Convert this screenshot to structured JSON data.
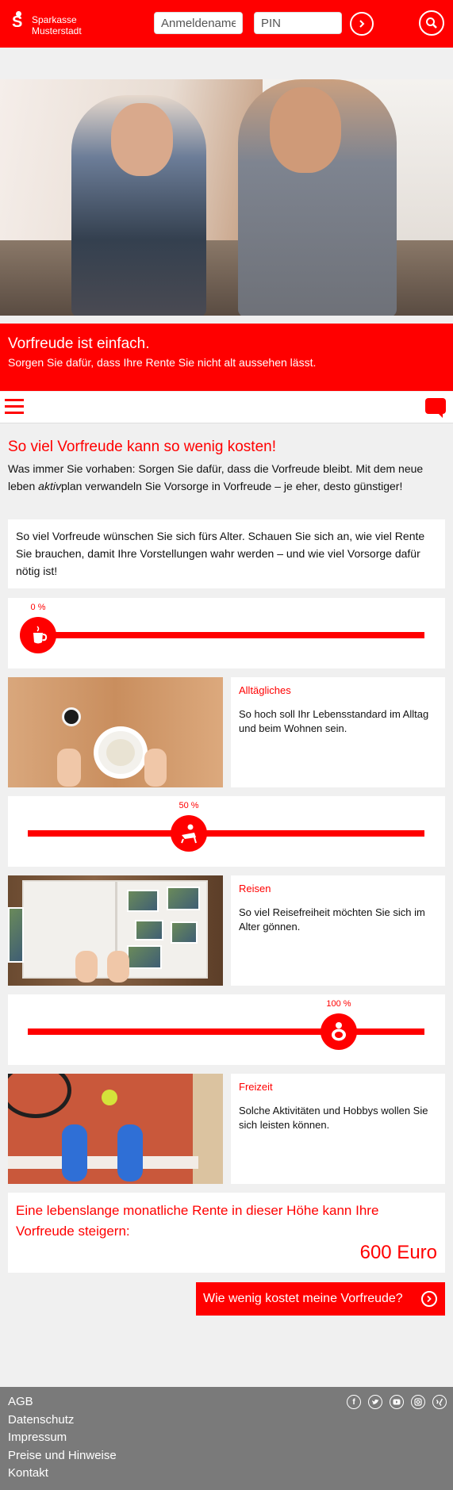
{
  "header": {
    "logo_line1": "Sparkasse",
    "logo_line2": "Musterstadt",
    "login_name_placeholder": "Anmeldename",
    "pin_placeholder": "PIN"
  },
  "banner": {
    "title": "Vorfreude ist einfach.",
    "subtitle": "Sorgen Sie dafür, dass Ihre Rente Sie nicht alt aussehen lässt."
  },
  "intro": {
    "title": "So viel Vorfreude kann so wenig kosten!",
    "text_before": "Was immer Sie vorhaben: Sorgen Sie dafür, dass die Vorfreude bleibt. Mit dem neue leben ",
    "text_em": "aktiv",
    "text_after": "plan verwandeln Sie Vorsorge in Vorfreude – je eher, desto günstiger!"
  },
  "info_card": {
    "text": "So viel Vorfreude wünschen Sie sich fürs Alter. Schauen Sie sich an, wie viel Rente Sie brauchen, damit Ihre Vorstellungen wahr werden – und wie viel Vorsorge dafür nötig ist!"
  },
  "sliders": [
    {
      "percent_label": "0 %",
      "value": 0,
      "icon": "coffee-cup-icon"
    },
    {
      "percent_label": "50 %",
      "value": 50,
      "icon": "beach-chair-icon"
    },
    {
      "percent_label": "100 %",
      "value": 100,
      "icon": "tennis-player-icon"
    }
  ],
  "categories": [
    {
      "title": "Alltägliches",
      "text": "So hoch soll Ihr Lebensstandard im Alltag und beim Wohnen sein."
    },
    {
      "title": "Reisen",
      "text": "So viel Reisefreiheit möchten Sie sich im Alter gönnen."
    },
    {
      "title": "Freizeit",
      "text": "Solche Aktivitäten und Hobbys wollen Sie sich leisten können."
    }
  ],
  "result": {
    "question": "Eine lebenslange monatliche Rente in dieser Höhe kann Ihre Vorfreude steigern:",
    "amount": "600 Euro"
  },
  "cta": {
    "label": "Wie wenig kostet meine Vorfreude?"
  },
  "footer": {
    "links": [
      "AGB",
      "Datenschutz",
      "Impressum",
      "Preise und Hinweise",
      "Kontakt"
    ],
    "socials": [
      "facebook-icon",
      "twitter-icon",
      "youtube-icon",
      "instagram-icon",
      "xing-icon"
    ]
  },
  "colors": {
    "brand": "#ff0000",
    "footer": "#7a7a7a",
    "background": "#f0f0f0"
  }
}
